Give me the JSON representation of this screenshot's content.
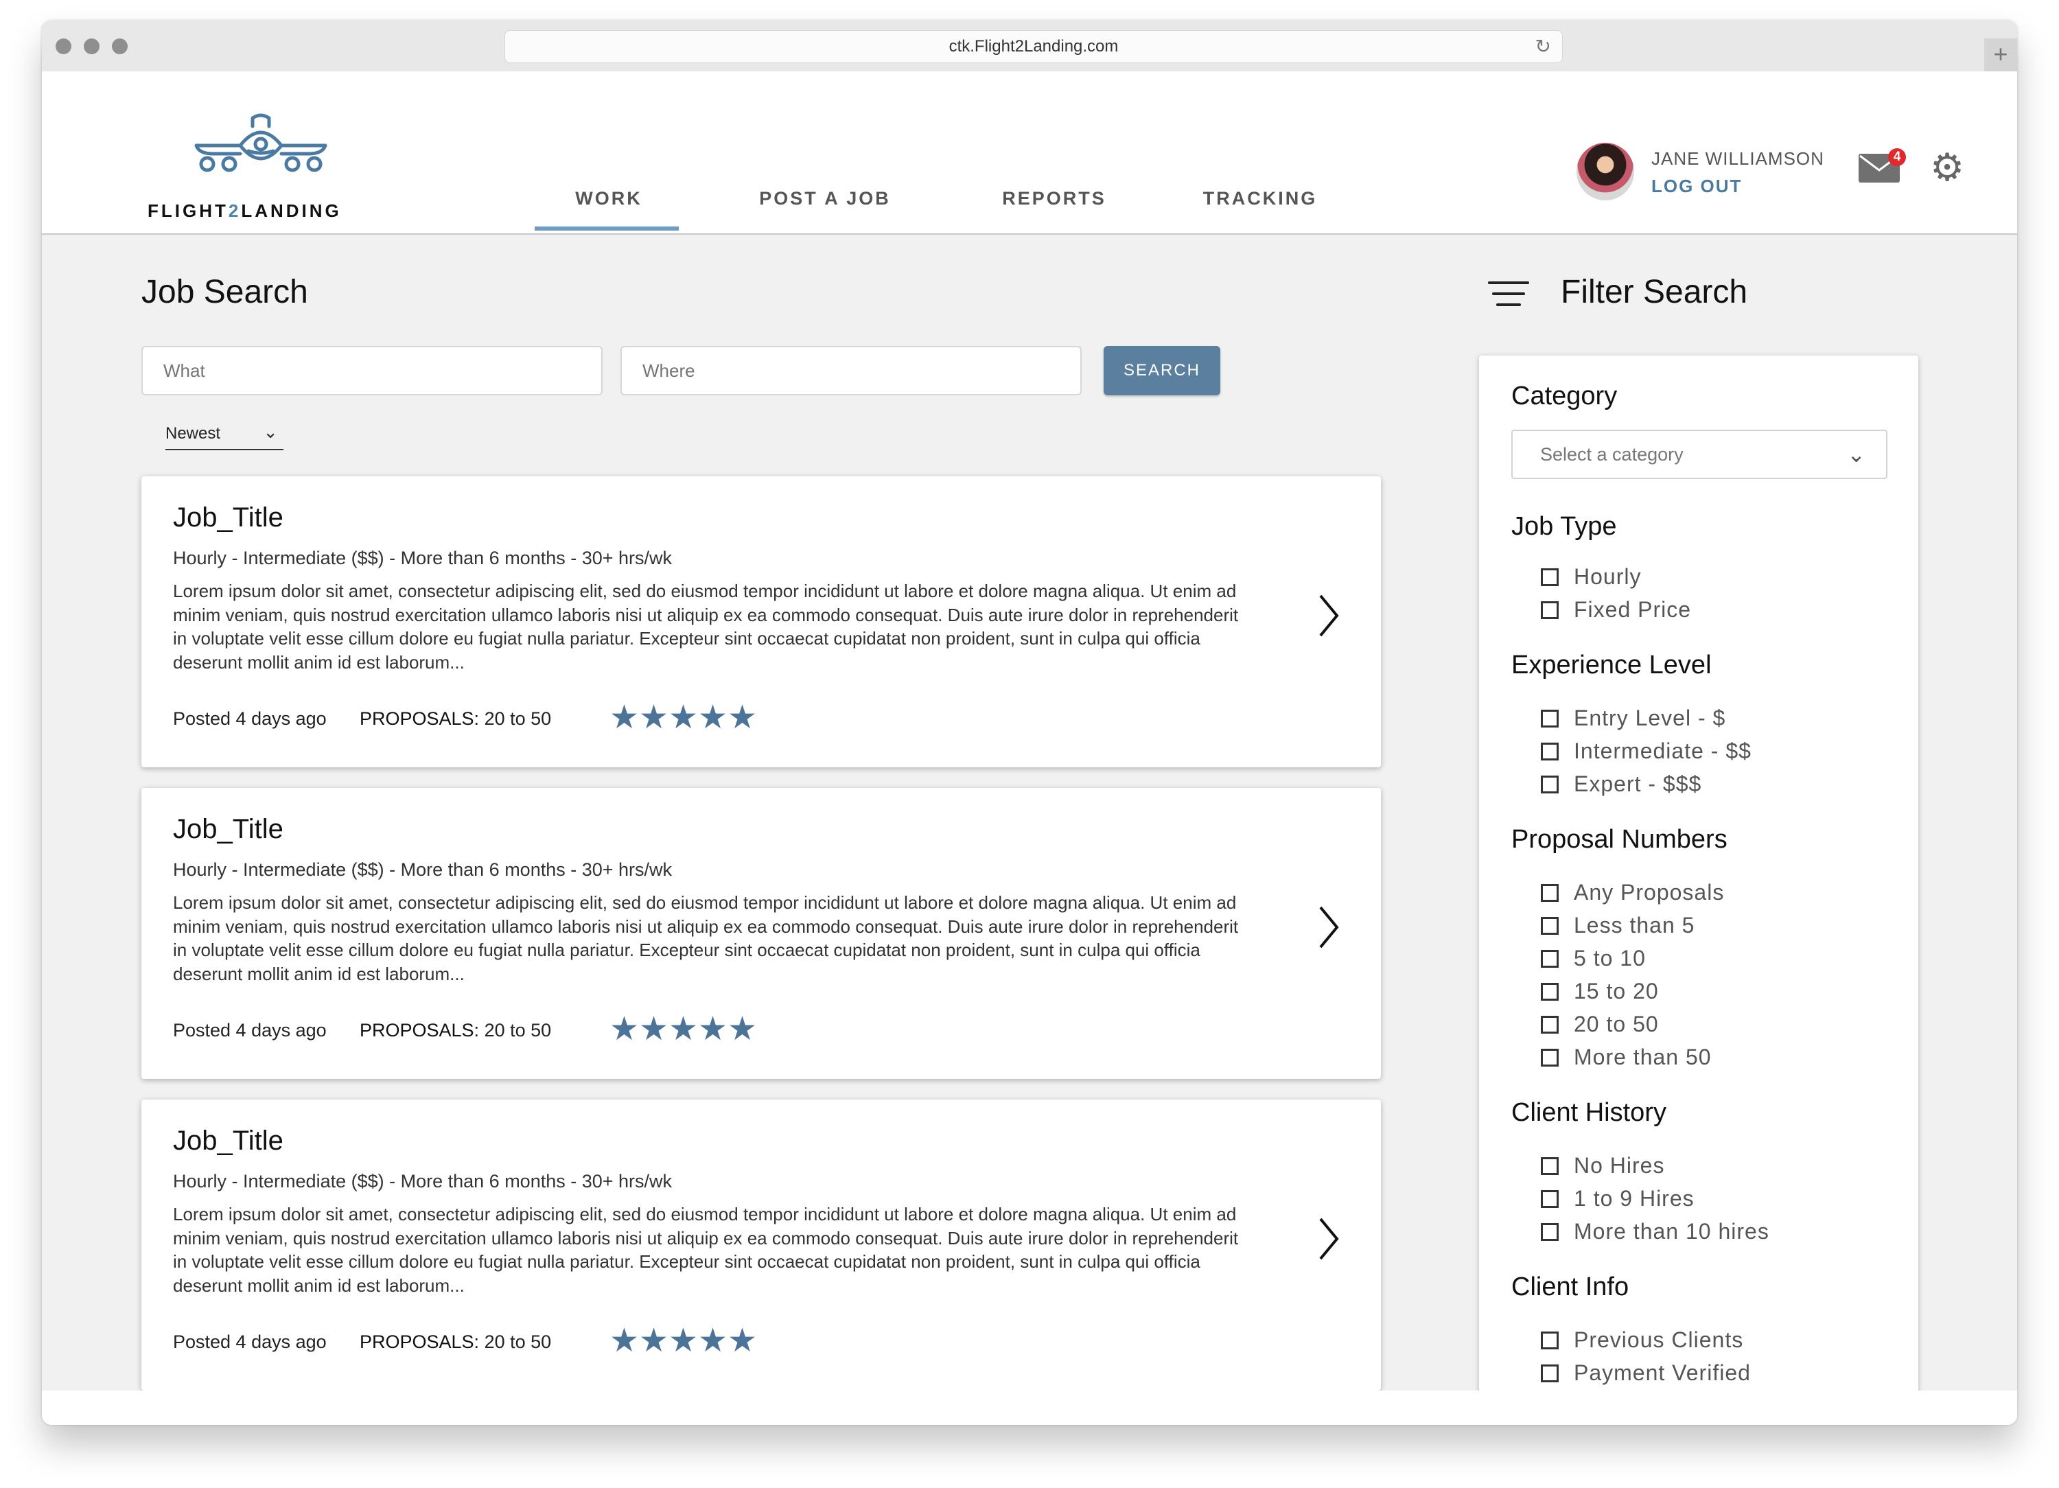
{
  "browser": {
    "url": "ctk.Flight2Landing.com",
    "reload_icon": "reload-icon",
    "new_tab_label": "+"
  },
  "brand": {
    "name_part1": "FLIGHT",
    "name_part2": "2",
    "name_part3": "LANDING",
    "accent": "#4a84b0"
  },
  "nav": [
    {
      "label": "WORK",
      "active": true
    },
    {
      "label": "POST A JOB",
      "active": false
    },
    {
      "label": "REPORTS",
      "active": false
    },
    {
      "label": "TRACKING",
      "active": false
    }
  ],
  "user": {
    "name": "JANE WILLIAMSON",
    "logout_label": "LOG OUT",
    "unread_messages": "4"
  },
  "job_search": {
    "title": "Job Search",
    "what_placeholder": "What",
    "where_placeholder": "Where",
    "search_label": "SEARCH",
    "sort_value": "Newest"
  },
  "jobs": [
    {
      "title": "Job_Title",
      "meta": "Hourly - Intermediate ($$) - More than 6 months - 30+ hrs/wk",
      "description": "Lorem ipsum dolor sit amet, consectetur adipiscing elit, sed do eiusmod tempor incididunt ut labore et dolore magna aliqua. Ut enim ad minim veniam, quis nostrud exercitation ullamco laboris nisi ut aliquip ex ea commodo consequat. Duis aute irure dolor in reprehenderit in voluptate velit esse cillum dolore eu fugiat nulla pariatur. Excepteur sint occaecat cupidatat non proident, sunt in culpa qui officia deserunt mollit anim id est laborum...",
      "posted": "Posted 4 days ago",
      "proposals_label": "PROPOSALS:",
      "proposals_value": "20 to 50",
      "rating": 5
    },
    {
      "title": "Job_Title",
      "meta": "Hourly - Intermediate ($$) - More than 6 months - 30+ hrs/wk",
      "description": "Lorem ipsum dolor sit amet, consectetur adipiscing elit, sed do eiusmod tempor incididunt ut labore et dolore magna aliqua. Ut enim ad minim veniam, quis nostrud exercitation ullamco laboris nisi ut aliquip ex ea commodo consequat. Duis aute irure dolor in reprehenderit in voluptate velit esse cillum dolore eu fugiat nulla pariatur. Excepteur sint occaecat cupidatat non proident, sunt in culpa qui officia deserunt mollit anim id est laborum...",
      "posted": "Posted 4 days ago",
      "proposals_label": "PROPOSALS:",
      "proposals_value": "20 to 50",
      "rating": 5
    },
    {
      "title": "Job_Title",
      "meta": "Hourly - Intermediate ($$) - More than 6 months - 30+ hrs/wk",
      "description": "Lorem ipsum dolor sit amet, consectetur adipiscing elit, sed do eiusmod tempor incididunt ut labore et dolore magna aliqua. Ut enim ad minim veniam, quis nostrud exercitation ullamco laboris nisi ut aliquip ex ea commodo consequat. Duis aute irure dolor in reprehenderit in voluptate velit esse cillum dolore eu fugiat nulla pariatur. Excepteur sint occaecat cupidatat non proident, sunt in culpa qui officia deserunt mollit anim id est laborum...",
      "posted": "Posted 4 days ago",
      "proposals_label": "PROPOSALS:",
      "proposals_value": "20 to 50",
      "rating": 5
    }
  ],
  "filter": {
    "title": "Filter Search",
    "category": {
      "title": "Category",
      "placeholder": "Select a category"
    },
    "job_type": {
      "title": "Job Type",
      "options": [
        "Hourly",
        "Fixed Price"
      ]
    },
    "experience": {
      "title": "Experience Level",
      "options": [
        "Entry Level - $",
        "Intermediate - $$",
        "Expert - $$$"
      ]
    },
    "proposals": {
      "title": "Proposal Numbers",
      "options": [
        "Any Proposals",
        "Less than 5",
        "5 to 10",
        "15 to 20",
        "20 to 50",
        "More than 50"
      ]
    },
    "client_history": {
      "title": "Client History",
      "options": [
        "No Hires",
        "1 to 9 Hires",
        "More than 10 hires"
      ]
    },
    "client_info": {
      "title": "Client Info",
      "options": [
        "Previous Clients",
        "Payment Verified"
      ]
    }
  },
  "colors": {
    "primary": "#5b7f9e",
    "star": "#4c7499",
    "badge": "#e2282a",
    "background": "#f1f1f1"
  }
}
